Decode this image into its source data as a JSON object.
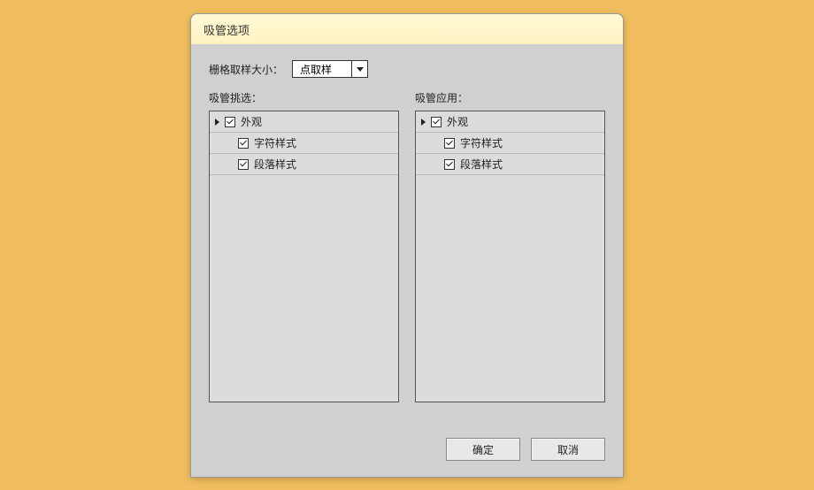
{
  "dialog": {
    "title": "吸管选项"
  },
  "sample_size": {
    "label": "栅格取样大小：",
    "value": "点取样"
  },
  "left_panel": {
    "label": "吸管挑选：",
    "items": [
      {
        "label": "外观"
      },
      {
        "label": "字符样式"
      },
      {
        "label": "段落样式"
      }
    ]
  },
  "right_panel": {
    "label": "吸管应用：",
    "items": [
      {
        "label": "外观"
      },
      {
        "label": "字符样式"
      },
      {
        "label": "段落样式"
      }
    ]
  },
  "buttons": {
    "ok": "确定",
    "cancel": "取消"
  }
}
